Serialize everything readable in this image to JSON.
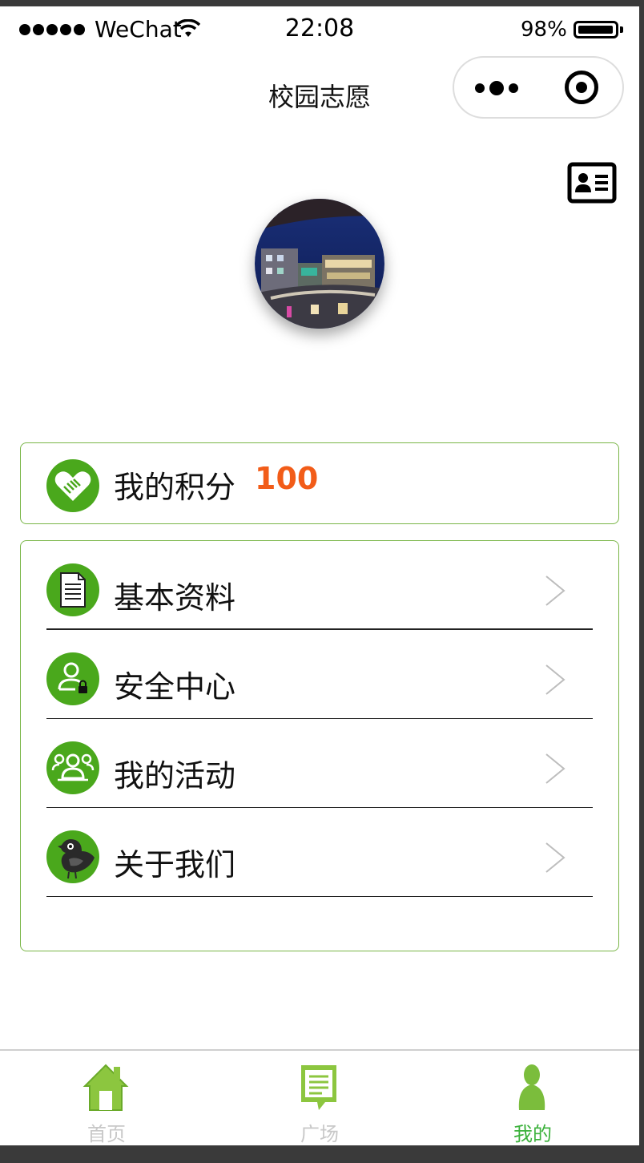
{
  "status_bar": {
    "carrier": "WeChat",
    "time": "22:08",
    "battery_percent_text": "98%",
    "battery_level": 0.98
  },
  "nav": {
    "title": "校园志愿"
  },
  "points": {
    "label": "我的积分",
    "value": "100",
    "value_color": "#f25c18"
  },
  "menu": {
    "items": [
      {
        "label": "基本资料",
        "icon": "document-icon"
      },
      {
        "label": "安全中心",
        "icon": "user-lock-icon"
      },
      {
        "label": "我的活动",
        "icon": "group-icon"
      },
      {
        "label": "关于我们",
        "icon": "bird-icon"
      }
    ]
  },
  "tabbar": {
    "tabs": [
      {
        "label": "首页",
        "icon": "home-icon",
        "active": false
      },
      {
        "label": "广场",
        "icon": "message-board-icon",
        "active": false
      },
      {
        "label": "我的",
        "icon": "person-icon",
        "active": true
      }
    ]
  },
  "colors": {
    "accent_green": "#4aa81c",
    "card_border": "#7ab648",
    "tab_active": "#3bb13b",
    "tab_inactive": "#c8c8c8"
  }
}
